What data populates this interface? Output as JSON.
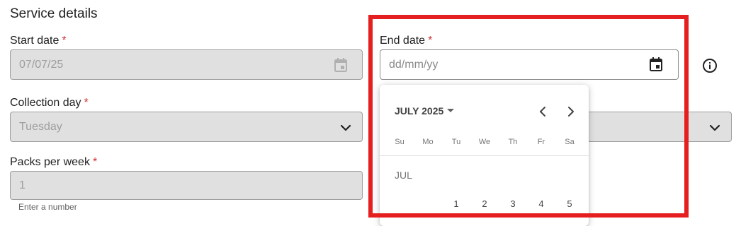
{
  "section_title": "Service details",
  "required_marker": "*",
  "start_date": {
    "label": "Start date",
    "value": "07/07/25",
    "icon": "calendar-icon"
  },
  "end_date": {
    "label": "End date",
    "placeholder": "dd/mm/yy",
    "icon": "calendar-icon"
  },
  "info_icon": "info-icon",
  "collection_day": {
    "label": "Collection day",
    "value": "Tuesday",
    "icon": "chevron-down-icon"
  },
  "packs_per_week": {
    "label": "Packs per week",
    "value": "1",
    "helper": "Enter a number"
  },
  "datepicker": {
    "month_year": "JULY 2025",
    "weekdays": [
      "Su",
      "Mo",
      "Tu",
      "We",
      "Th",
      "Fr",
      "Sa"
    ],
    "month_label": "JUL",
    "first_row": [
      "",
      "",
      "1",
      "2",
      "3",
      "4",
      "5"
    ]
  },
  "colors": {
    "required": "#d32f2f",
    "highlight": "#e51f1f",
    "disabled_bg": "#e0e0e0"
  }
}
